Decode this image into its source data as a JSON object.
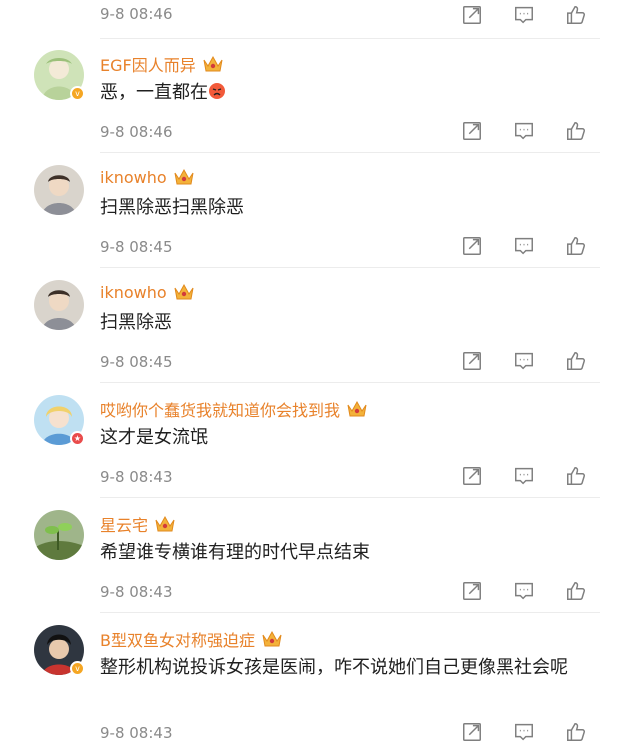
{
  "top": {
    "time": "9-8 08:46"
  },
  "comments": [
    {
      "username": "EGF因人而异",
      "text": "恶，一直都在",
      "time": "9-8 08:46",
      "badge": "vip"
    },
    {
      "username": "iknowho",
      "text": "扫黑除恶扫黑除恶",
      "time": "9-8 08:45"
    },
    {
      "username": "iknowho",
      "text": "扫黑除恶",
      "time": "9-8 08:45"
    },
    {
      "username": "哎哟你个蠢货我就知道你会找到我",
      "text": "这才是女流氓",
      "time": "9-8 08:43",
      "badge": "star"
    },
    {
      "username": "星云宅",
      "text": "希望谁专横谁有理的时代早点结束",
      "time": "9-8 08:43"
    },
    {
      "username": "B型双鱼女对称强迫症",
      "text": "整形机构说投诉女孩是医闹，咋不说她们自己更像黑社会呢",
      "time": "9-8 08:43",
      "badge": "vip"
    }
  ],
  "icons": {
    "share": "share-icon",
    "comment": "comment-icon",
    "like": "like-icon",
    "crown": "crown-icon"
  },
  "colors": {
    "username": "#e8822b",
    "time": "#8a8a8a",
    "icon": "#7f7f7f",
    "divider": "#ececec"
  }
}
